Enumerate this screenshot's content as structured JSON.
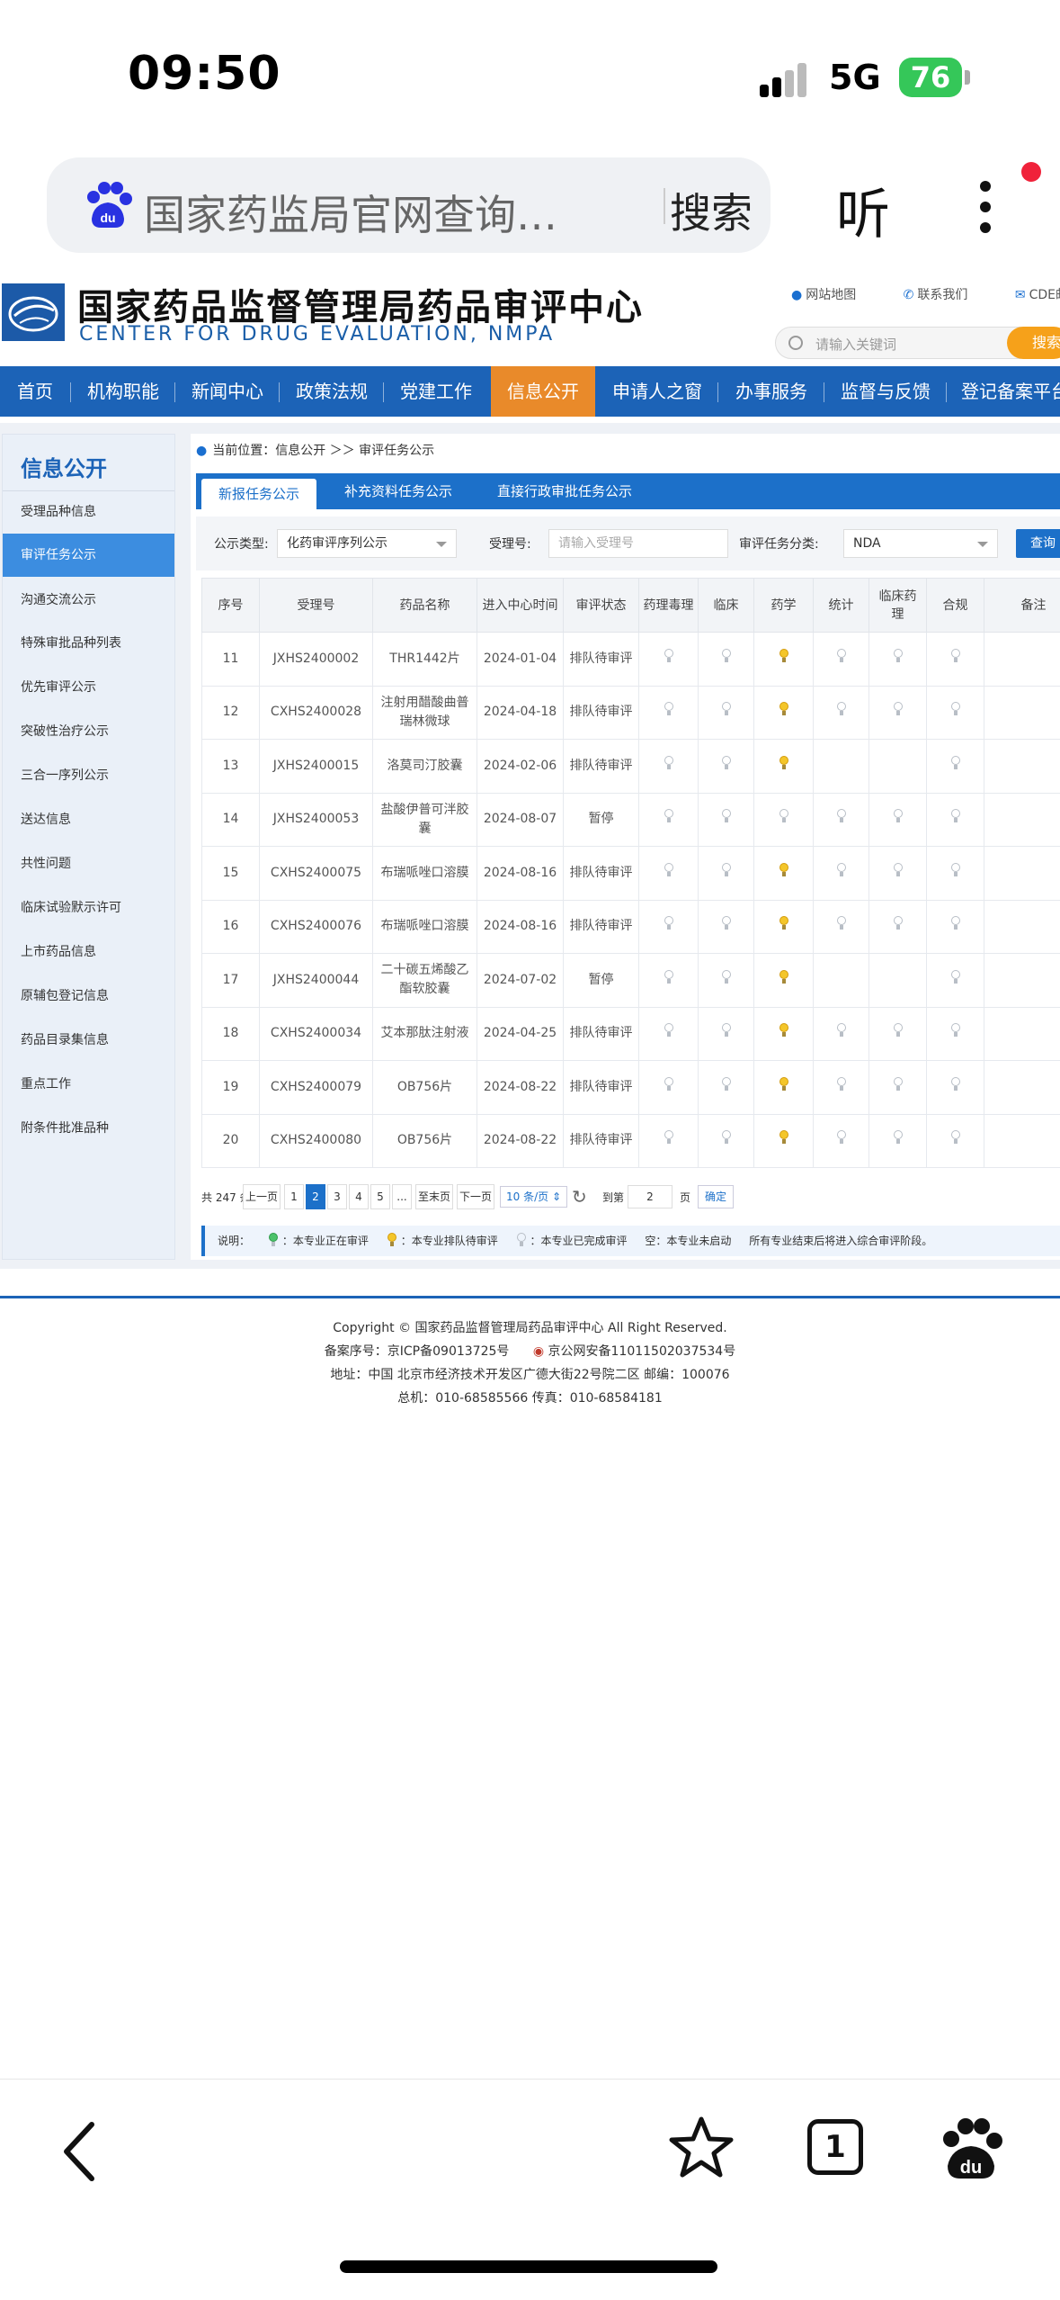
{
  "status": {
    "time": "09:50",
    "network": "5G",
    "battery": "76"
  },
  "browser": {
    "query": "国家药监局官网查询…",
    "search_label": "搜索",
    "listen_label": "听",
    "tab_count": "1"
  },
  "site": {
    "title": "国家药品监督管理局药品审评中心",
    "subtitle": "CENTER FOR DRUG EVALUATION, NMPA",
    "top_links": [
      "网站地图",
      "联系我们",
      "CDE邮"
    ],
    "search_placeholder": "请输入关键词",
    "search_button": "搜索",
    "nav": [
      "首页",
      "机构职能",
      "新闻中心",
      "政策法规",
      "党建工作",
      "信息公开",
      "申请人之窗",
      "办事服务",
      "监督与反馈",
      "登记备案平台"
    ],
    "nav_active": "信息公开"
  },
  "sidebar": {
    "heading": "信息公开",
    "items": [
      "受理品种信息",
      "审评任务公示",
      "沟通交流公示",
      "特殊审批品种列表",
      "优先审评公示",
      "突破性治疗公示",
      "三合一序列公示",
      "送达信息",
      "共性问题",
      "临床试验默示许可",
      "上市药品信息",
      "原辅包登记信息",
      "药品目录集信息",
      "重点工作",
      "附条件批准品种"
    ],
    "active": "审评任务公示"
  },
  "main": {
    "breadcrumb": "当前位置：信息公开 ＞＞ 审评任务公示",
    "tabs": [
      "新报任务公示",
      "补充资料任务公示",
      "直接行政审批任务公示"
    ],
    "filters": {
      "type_label": "公示类型:",
      "type_value": "化药审评序列公示",
      "accept_label": "受理号:",
      "accept_placeholder": "请输入受理号",
      "class_label": "审评任务分类:",
      "class_value": "NDA",
      "query_button": "查询"
    },
    "table": {
      "headers": [
        "序号",
        "受理号",
        "药品名称",
        "进入中心时间",
        "审评状态",
        "药理毒理",
        "临床",
        "药学",
        "统计",
        "临床药理",
        "合规",
        "备注"
      ],
      "rows": [
        {
          "no": "11",
          "id": "JXHS2400002",
          "name": "THR1442片",
          "date": "2024-01-04",
          "status": "排队待审评",
          "lights": [
            "done",
            "done",
            "pending",
            "done",
            "done",
            "done"
          ]
        },
        {
          "no": "12",
          "id": "CXHS2400028",
          "name": "注射用醋酸曲普瑞林微球",
          "date": "2024-04-18",
          "status": "排队待审评",
          "lights": [
            "done",
            "done",
            "pending",
            "done",
            "done",
            "done"
          ]
        },
        {
          "no": "13",
          "id": "JXHS2400015",
          "name": "洛莫司汀胶囊",
          "date": "2024-02-06",
          "status": "排队待审评",
          "lights": [
            "done",
            "done",
            "pending",
            "",
            "",
            "done"
          ]
        },
        {
          "no": "14",
          "id": "JXHS2400053",
          "name": "盐酸伊普可泮胶囊",
          "date": "2024-08-07",
          "status": "暂停",
          "lights": [
            "done",
            "done",
            "done",
            "done",
            "done",
            "done"
          ]
        },
        {
          "no": "15",
          "id": "CXHS2400075",
          "name": "布瑞哌唑口溶膜",
          "date": "2024-08-16",
          "status": "排队待审评",
          "lights": [
            "done",
            "done",
            "pending",
            "done",
            "done",
            "done"
          ]
        },
        {
          "no": "16",
          "id": "CXHS2400076",
          "name": "布瑞哌唑口溶膜",
          "date": "2024-08-16",
          "status": "排队待审评",
          "lights": [
            "done",
            "done",
            "pending",
            "done",
            "done",
            "done"
          ]
        },
        {
          "no": "17",
          "id": "JXHS2400044",
          "name": "二十碳五烯酸乙酯软胶囊",
          "date": "2024-07-02",
          "status": "暂停",
          "lights": [
            "done",
            "done",
            "pending",
            "",
            "",
            "done"
          ]
        },
        {
          "no": "18",
          "id": "CXHS2400034",
          "name": "艾本那肽注射液",
          "date": "2024-04-25",
          "status": "排队待审评",
          "lights": [
            "done",
            "done",
            "pending",
            "done",
            "done",
            "done"
          ]
        },
        {
          "no": "19",
          "id": "CXHS2400079",
          "name": "OB756片",
          "date": "2024-08-22",
          "status": "排队待审评",
          "lights": [
            "done",
            "done",
            "pending",
            "done",
            "done",
            "done"
          ]
        },
        {
          "no": "20",
          "id": "CXHS2400080",
          "name": "OB756片",
          "date": "2024-08-22",
          "status": "排队待审评",
          "lights": [
            "done",
            "done",
            "pending",
            "done",
            "done",
            "done"
          ]
        }
      ]
    },
    "pager": {
      "total": "共 247 条",
      "prev": "上一页",
      "pages": [
        "1",
        "2",
        "3",
        "4",
        "5",
        "..."
      ],
      "current": "2",
      "last": "至末页",
      "next": "下一页",
      "per_page": "10 条/页",
      "goto_label": "到第",
      "goto_value": "2",
      "page_unit": "页",
      "confirm": "确定"
    },
    "legend": {
      "label": "说明：",
      "active": "：本专业正在审评",
      "pending": "：本专业排队待审评",
      "done": "：本专业已完成审评",
      "empty": "空：本专业未启动",
      "note": "所有专业结束后将进入综合审评阶段。"
    }
  },
  "footer": {
    "copyright": "Copyright © 国家药品监督管理局药品审评中心   All Right Reserved.",
    "icp": "备案序号：京ICP备09013725号",
    "police": "京公网安备11011502037534号",
    "address": "地址：中国 北京市经济技术开发区广德大街22号院二区      邮编：100076",
    "phone": "总机：010-68585566      传真：010-68584181"
  }
}
